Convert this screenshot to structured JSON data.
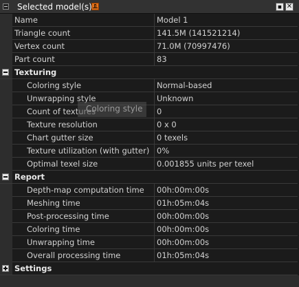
{
  "panel": {
    "title": "Selected model(s)",
    "close_label": "✕",
    "max_label": "◼"
  },
  "general": [
    {
      "label": "Name",
      "value": "Model 1"
    },
    {
      "label": "Triangle count",
      "value": "141.5M (141521214)"
    },
    {
      "label": "Vertex count",
      "value": "71.0M (70997476)"
    },
    {
      "label": "Part count",
      "value": "83"
    }
  ],
  "texturing": {
    "label": "Texturing",
    "rows": [
      {
        "label": "Coloring style",
        "value": "Normal-based"
      },
      {
        "label": "Unwrapping style",
        "value": "Unknown"
      },
      {
        "label": "Count of textures",
        "value": "0"
      },
      {
        "label": "Texture resolution",
        "value": "0 x 0"
      },
      {
        "label": "Chart gutter size",
        "value": "0 texels"
      },
      {
        "label": "Texture utilization (with gutter)",
        "value": "0%"
      },
      {
        "label": "Optimal texel size",
        "value": "0.001855 units per texel"
      }
    ]
  },
  "report": {
    "label": "Report",
    "rows": [
      {
        "label": "Depth-map computation time",
        "value": "00h:00m:00s"
      },
      {
        "label": "Meshing time",
        "value": "01h:05m:04s"
      },
      {
        "label": "Post-processing time",
        "value": "00h:00m:00s"
      },
      {
        "label": "Coloring time",
        "value": "00h:00m:00s"
      },
      {
        "label": "Unwrapping time",
        "value": "00h:00m:00s"
      },
      {
        "label": "Overall processing time",
        "value": "01h:05m:04s"
      }
    ]
  },
  "settings": {
    "label": "Settings"
  },
  "tooltip": {
    "text": "Coloring style"
  }
}
